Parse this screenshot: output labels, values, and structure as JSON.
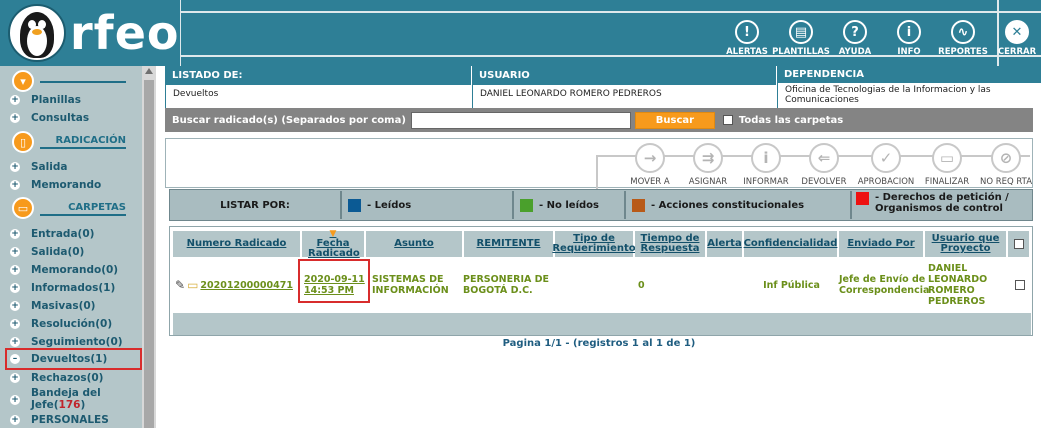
{
  "app": {
    "logo_text": "rfeo"
  },
  "toolbar": [
    {
      "label": "ALERTAS",
      "glyph": "!"
    },
    {
      "label": "PLANTILLAS",
      "glyph": "▤"
    },
    {
      "label": "AYUDA",
      "glyph": "?"
    },
    {
      "label": "INFO",
      "glyph": "i"
    },
    {
      "label": "REPORTES",
      "glyph": "∿"
    },
    {
      "label": "CERRAR",
      "glyph": "✕"
    }
  ],
  "sidebar": {
    "menu_circle_glyph": "▾",
    "top_items": [
      {
        "label": "Planillas"
      },
      {
        "label": "Consultas"
      }
    ],
    "radicacion": {
      "title": "RADICACIÓN",
      "glyph": "▯",
      "items": [
        {
          "label": "Salida"
        },
        {
          "label": "Memorando"
        }
      ]
    },
    "carpetas": {
      "title": "CARPETAS",
      "glyph": "▭",
      "items": [
        {
          "label": "Entrada(0)"
        },
        {
          "label": "Salida(0)"
        },
        {
          "label": "Memorando(0)"
        },
        {
          "label": "Informados(1)"
        },
        {
          "label": "Masivas(0)"
        },
        {
          "label": "Resolución(0)"
        },
        {
          "label": "Seguimiento(0)"
        },
        {
          "label": "Devueltos(1)"
        },
        {
          "label": "Rechazos(0)"
        }
      ]
    },
    "bandeja": {
      "label_prefix": "Bandeja del Jefe(",
      "count": "176",
      "label_suffix": ")"
    },
    "personales": {
      "label": "PERSONALES"
    }
  },
  "info": {
    "listado_header": "LISTADO DE:",
    "listado_value": "Devueltos",
    "usuario_header": "USUARIO",
    "usuario_value": "DANIEL LEONARDO ROMERO PEDREROS",
    "dependencia_header": "DEPENDENCIA",
    "dependencia_value": "Oficina de Tecnologias de la Informacion y las Comunicaciones"
  },
  "search": {
    "label": "Buscar radicado(s) (Separados por coma)",
    "value": "",
    "button": "Buscar",
    "checkbox_label": "Todas las carpetas"
  },
  "actions": [
    {
      "label": "MOVER A",
      "glyph": "→"
    },
    {
      "label": "ASIGNAR",
      "glyph": "⇉"
    },
    {
      "label": "INFORMAR",
      "glyph": "i"
    },
    {
      "label": "DEVOLVER",
      "glyph": "⇐"
    },
    {
      "label": "APROBACION",
      "glyph": "✓"
    },
    {
      "label": "FINALIZAR",
      "glyph": "▭"
    },
    {
      "label": "NO REQ RTA",
      "glyph": "⊘"
    }
  ],
  "filters": {
    "label": "LISTAR POR:",
    "items": [
      {
        "label": "- Leídos",
        "color": "#0b5a94"
      },
      {
        "label": "- No leídos",
        "color": "#4aa02c"
      },
      {
        "label": "- Acciones constitucionales",
        "color": "#b85a18"
      },
      {
        "label": "- Derechos de petición / Organismos de control",
        "color": "#ee1111"
      }
    ]
  },
  "table": {
    "headers": [
      "Numero Radicado",
      "Fecha Radicado",
      "Asunto",
      "REMITENTE",
      "Tipo de Requerimiento",
      "Tiempo de Respuesta",
      "Alerta",
      "Confidencialidad",
      "Enviado Por",
      "Usuario que Proyecto"
    ],
    "sort_indicator": "▼",
    "rows": [
      {
        "radicado": "20201200000471",
        "fecha": "2020-09-11 14:53 PM",
        "asunto": "SISTEMAS DE INFORMACIÓN",
        "remitente": "PERSONERIA DE BOGOTÁ D.C.",
        "tipo": "",
        "tiempo": "0",
        "alerta": "",
        "confidencialidad": "Inf Pública",
        "enviado_por": "Jefe de Envío de Correspondencia",
        "usuario_proyecto": "DANIEL LEONARDO ROMERO PEDREROS"
      }
    ]
  },
  "pagination": {
    "text": "Pagina 1/1    -    (registros 1 al 1 de 1)"
  }
}
